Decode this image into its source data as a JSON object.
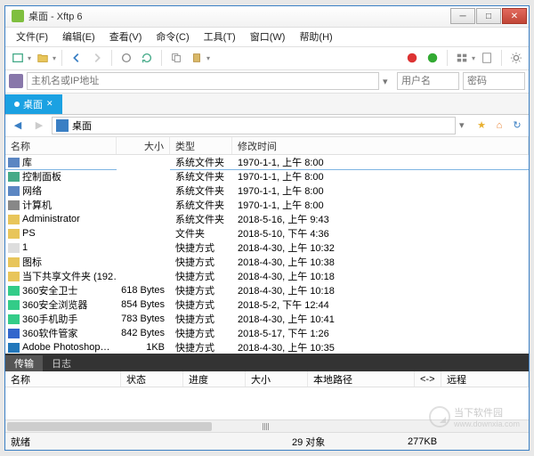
{
  "window": {
    "title": "桌面 - Xftp 6"
  },
  "menu": [
    "文件(F)",
    "编辑(E)",
    "查看(V)",
    "命令(C)",
    "工具(T)",
    "窗口(W)",
    "帮助(H)"
  ],
  "address": {
    "placeholder": "主机名或IP地址",
    "user_ph": "用户名",
    "pass_ph": "密码"
  },
  "tab": {
    "label": "桌面"
  },
  "path": {
    "label": "桌面"
  },
  "cols": {
    "name": "名称",
    "size": "大小",
    "type": "类型",
    "date": "修改时间"
  },
  "files": [
    {
      "name": "库",
      "size": "",
      "type": "系统文件夹",
      "date": "1970-1-1, 上午 8:00",
      "icon": "#5b86c2",
      "sel": true
    },
    {
      "name": "控制面板",
      "size": "",
      "type": "系统文件夹",
      "date": "1970-1-1, 上午 8:00",
      "icon": "#4a8"
    },
    {
      "name": "网络",
      "size": "",
      "type": "系统文件夹",
      "date": "1970-1-1, 上午 8:00",
      "icon": "#5b86c2"
    },
    {
      "name": "计算机",
      "size": "",
      "type": "系统文件夹",
      "date": "1970-1-1, 上午 8:00",
      "icon": "#888"
    },
    {
      "name": "Administrator",
      "size": "",
      "type": "系统文件夹",
      "date": "2018-5-16, 上午 9:43",
      "icon": "#e8c55a"
    },
    {
      "name": "PS",
      "size": "",
      "type": "文件夹",
      "date": "2018-5-10, 下午 4:36",
      "icon": "#e8c55a"
    },
    {
      "name": "1",
      "size": "",
      "type": "快捷方式",
      "date": "2018-4-30, 上午 10:32",
      "icon": "#ddd"
    },
    {
      "name": "图标",
      "size": "",
      "type": "快捷方式",
      "date": "2018-4-30, 上午 10:38",
      "icon": "#e8c55a"
    },
    {
      "name": "当下共享文件夹 (192…",
      "size": "",
      "type": "快捷方式",
      "date": "2018-4-30, 上午 10:18",
      "icon": "#e8c55a"
    },
    {
      "name": "360安全卫士",
      "size": "618 Bytes",
      "type": "快捷方式",
      "date": "2018-4-30, 上午 10:18",
      "icon": "#3c8"
    },
    {
      "name": "360安全浏览器",
      "size": "854 Bytes",
      "type": "快捷方式",
      "date": "2018-5-2, 下午 12:44",
      "icon": "#3c8"
    },
    {
      "name": "360手机助手",
      "size": "783 Bytes",
      "type": "快捷方式",
      "date": "2018-4-30, 上午 10:41",
      "icon": "#3c8"
    },
    {
      "name": "360软件管家",
      "size": "842 Bytes",
      "type": "快捷方式",
      "date": "2018-5-17, 下午 1:26",
      "icon": "#36c"
    },
    {
      "name": "Adobe Photoshop…",
      "size": "1KB",
      "type": "快捷方式",
      "date": "2018-4-30, 上午 10:35",
      "icon": "#27b"
    }
  ],
  "transfer": {
    "tabs": [
      "传输",
      "日志"
    ],
    "cols": {
      "name": "名称",
      "status": "状态",
      "progress": "进度",
      "size": "大小",
      "localpath": "本地路径",
      "arrow": "<->",
      "remote": "远程"
    }
  },
  "status": {
    "left": "就绪",
    "objects": "29 对象",
    "size": "277KB"
  },
  "watermark": {
    "title": "当下软件园",
    "url": "www.downxia.com"
  }
}
